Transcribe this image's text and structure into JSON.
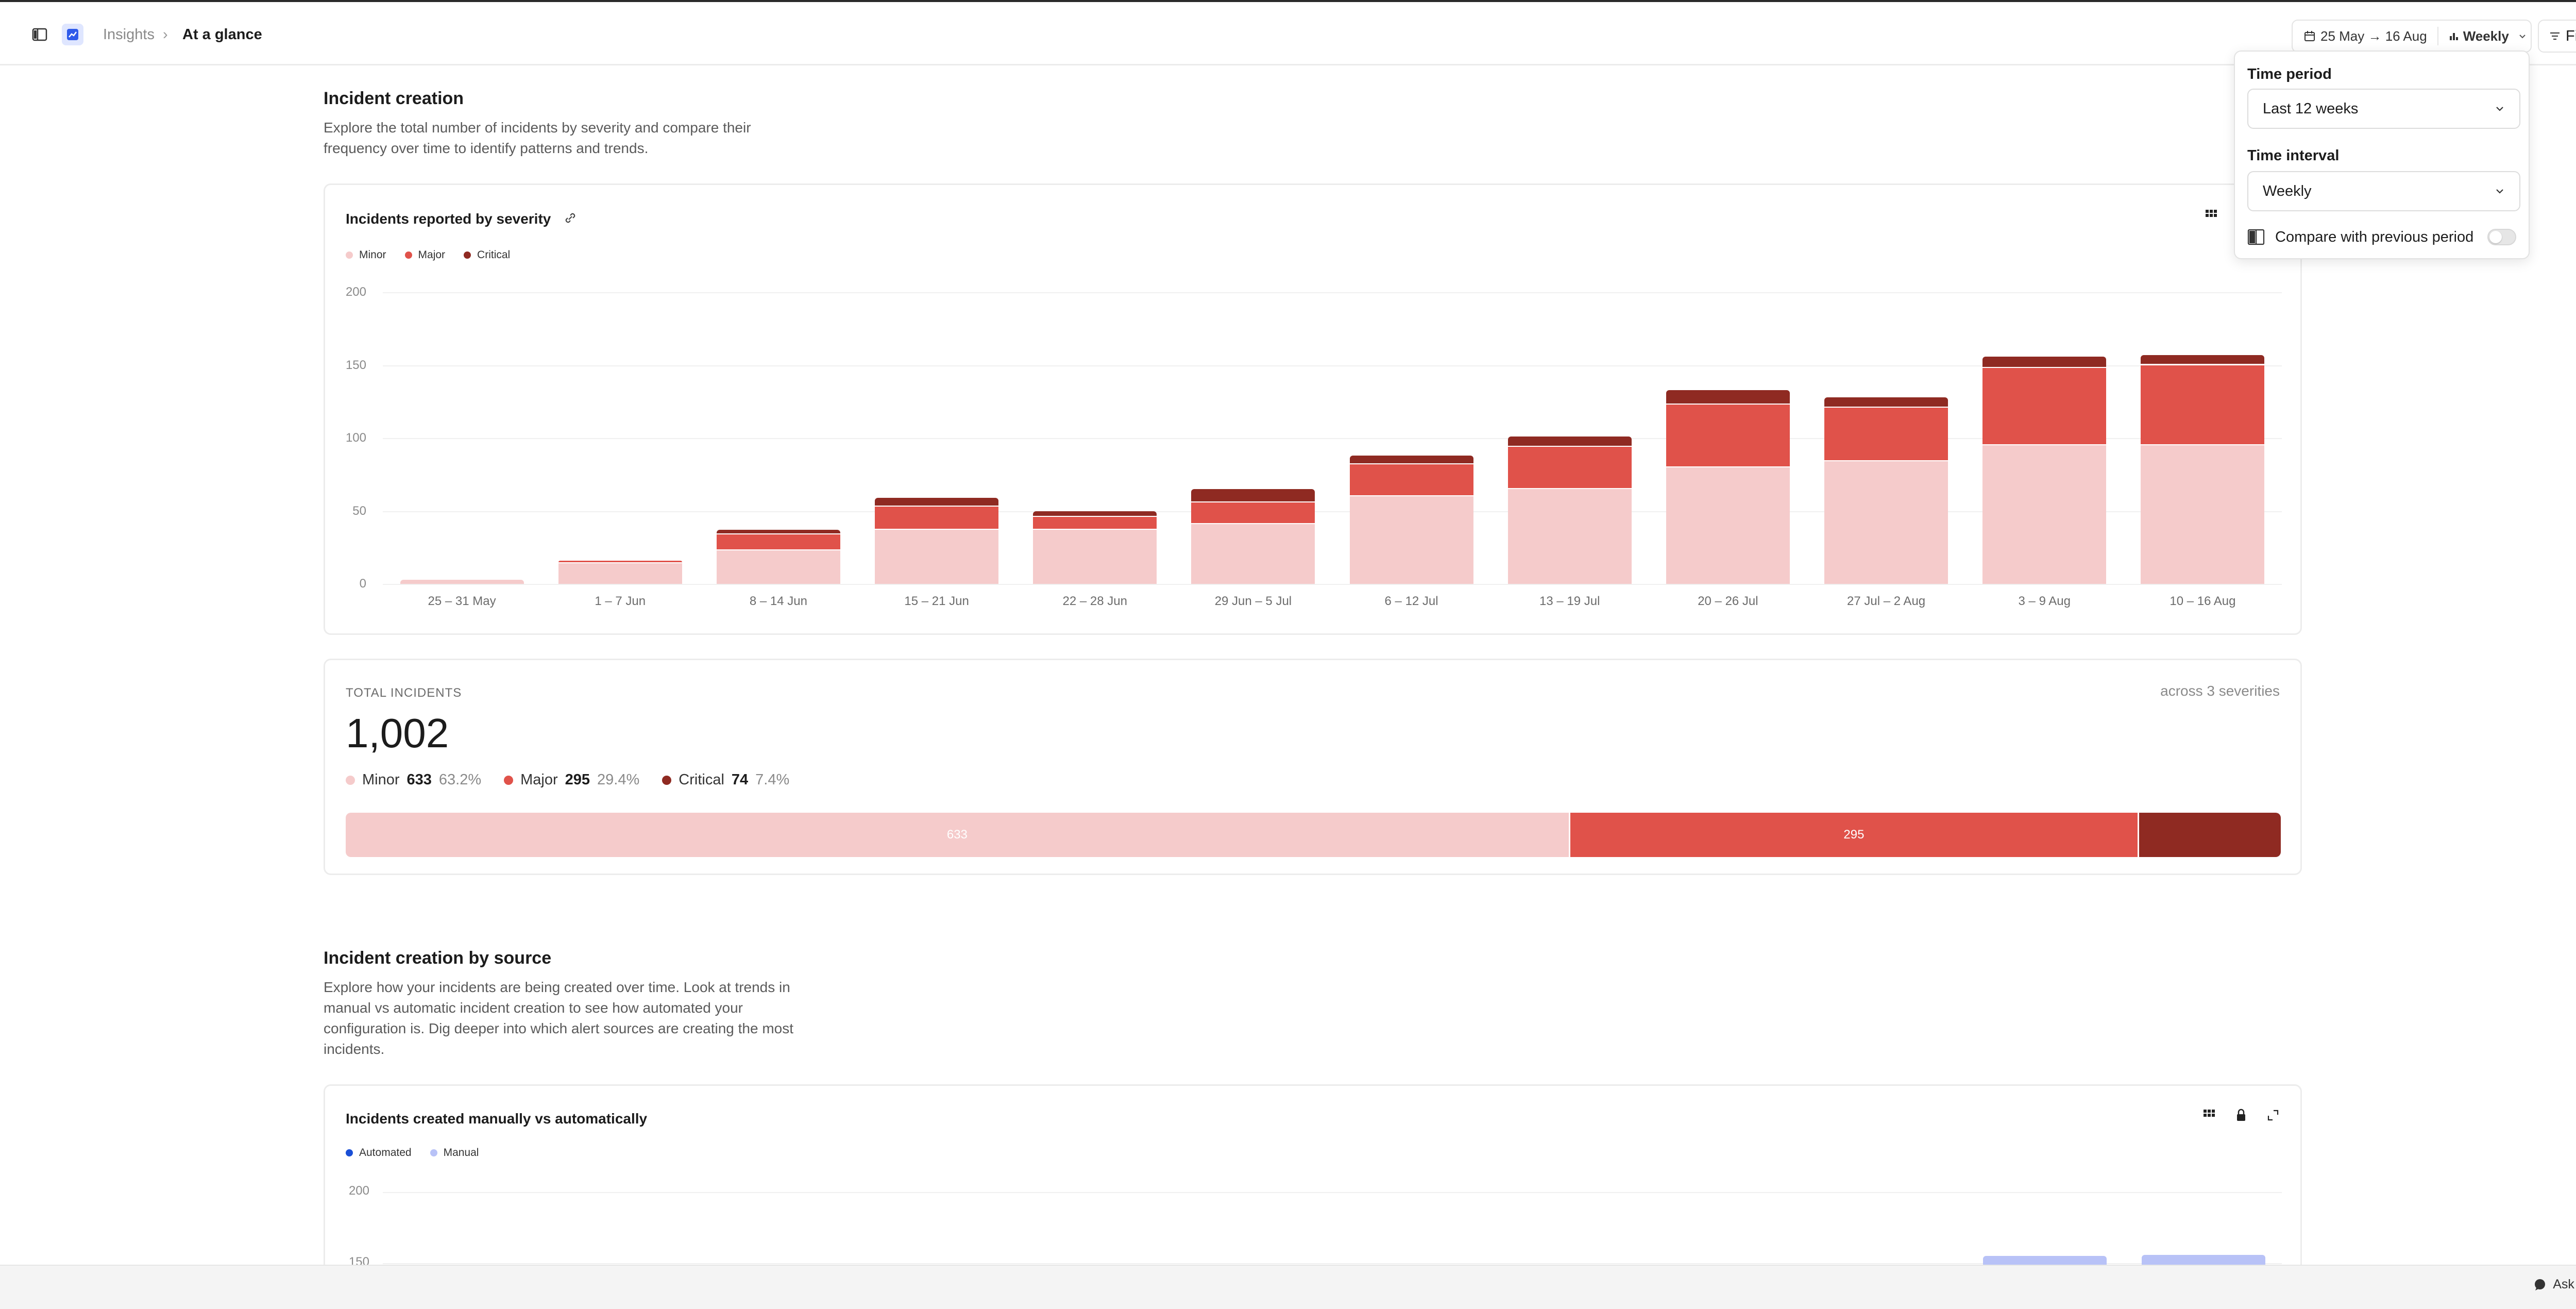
{
  "breadcrumb": {
    "parent": "Insights",
    "current": "At a glance"
  },
  "toolbar": {
    "date_range": "25 May → 16 Aug",
    "interval": "Weekly",
    "filter": "Filter"
  },
  "popover": {
    "time_period_label": "Time period",
    "time_period_value": "Last 12 weeks",
    "time_interval_label": "Time interval",
    "time_interval_value": "Weekly",
    "compare_label": "Compare with previous period",
    "compare_enabled": false
  },
  "section1": {
    "title": "Incident creation",
    "description": "Explore the total number of incidents by severity and compare their frequency over time to identify patterns and trends."
  },
  "chart1": {
    "title": "Incidents reported by severity",
    "legend": [
      {
        "name": "Minor",
        "color": "#f5cbcb"
      },
      {
        "name": "Major",
        "color": "#e0524a"
      },
      {
        "name": "Critical",
        "color": "#8f2a22"
      }
    ]
  },
  "chart_data": [
    {
      "type": "bar",
      "stacked": true,
      "title": "Incidents reported by severity",
      "categories": [
        "25 – 31 May",
        "1 – 7 Jun",
        "8 – 14 Jun",
        "15 – 21 Jun",
        "22 – 28 Jun",
        "29 Jun – 5 Jul",
        "6 – 12 Jul",
        "13 – 19 Jul",
        "20 – 26 Jul",
        "27 Jul – 2 Aug",
        "3 – 9 Aug",
        "10 – 16 Aug"
      ],
      "series": [
        {
          "name": "Minor",
          "color": "#f5cbcb",
          "values": [
            3,
            14,
            23,
            37,
            37,
            41,
            60,
            65,
            80,
            84,
            95,
            95
          ]
        },
        {
          "name": "Major",
          "color": "#e0524a",
          "values": [
            0,
            2,
            11,
            16,
            9,
            15,
            22,
            29,
            43,
            37,
            53,
            55
          ]
        },
        {
          "name": "Critical",
          "color": "#8f2a22",
          "values": [
            0,
            0,
            3,
            6,
            4,
            9,
            6,
            7,
            10,
            7,
            8,
            7
          ]
        }
      ],
      "yticks": [
        0,
        50,
        100,
        150,
        200
      ],
      "ylim": [
        0,
        200
      ],
      "grid": true,
      "legend": "top-left"
    },
    {
      "type": "bar",
      "stacked": true,
      "title": "Incidents created manually vs automatically",
      "series": [
        {
          "name": "Automated",
          "color": "#1a4fd6"
        },
        {
          "name": "Manual",
          "color": "#b8c2f7"
        }
      ],
      "yticks": [
        150,
        200
      ],
      "ylim": [
        0,
        200
      ],
      "grid": true,
      "legend": "top-left"
    }
  ],
  "summary": {
    "label": "TOTAL INCIDENTS",
    "total": "1,002",
    "right_note": "across 3 severities",
    "items": [
      {
        "name": "Minor",
        "count": "633",
        "pct": "63.2%",
        "color": "#f5cbcb",
        "fraction": 0.632
      },
      {
        "name": "Major",
        "count": "295",
        "pct": "29.4%",
        "color": "#e0524a",
        "fraction": 0.294
      },
      {
        "name": "Critical",
        "count": "74",
        "pct": "7.4%",
        "color": "#8f2a22",
        "fraction": 0.074
      }
    ],
    "bar_labels": [
      "633",
      "295",
      ""
    ]
  },
  "section2": {
    "title": "Incident creation by source",
    "description": "Explore how your incidents are being created over time. Look at trends in manual vs automatic incident creation to see how automated your configuration is. Dig deeper into which alert sources are creating the most incidents."
  },
  "chart2": {
    "title": "Incidents created manually vs automatically",
    "legend": [
      {
        "name": "Automated",
        "color": "#1a4fd6"
      },
      {
        "name": "Manual",
        "color": "#b8c2f7"
      }
    ],
    "ytick_top": "200",
    "ytick_partial": "150"
  },
  "footer": {
    "ask_label": "Ask incident"
  }
}
